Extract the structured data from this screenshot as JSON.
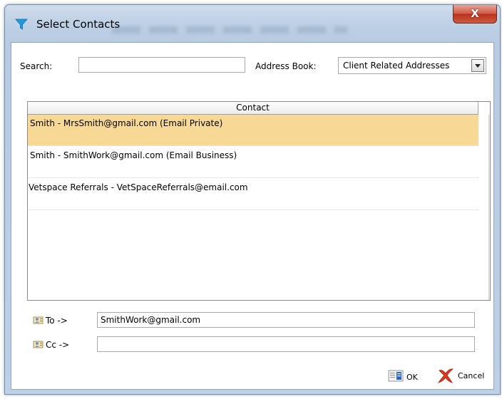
{
  "window": {
    "title": "Select Contacts",
    "close_glyph": "X"
  },
  "search": {
    "label": "Search:",
    "value": ""
  },
  "address_book": {
    "label": "Address Book:",
    "selected": "Client Related Addresses"
  },
  "contacts": {
    "column_header": "Contact",
    "rows": [
      {
        "text": "Smith - MrsSmith@gmail.com (Email Private)",
        "selected": true
      },
      {
        "text": "Smith - SmithWork@gmail.com (Email Business)",
        "selected": false
      },
      {
        "text": "Vetspace Referrals - VetSpaceReferrals@email.com",
        "selected": false
      }
    ]
  },
  "recipients": {
    "to_label": "To ->",
    "to_value": "SmithWork@gmail.com",
    "cc_label": "Cc ->",
    "cc_value": ""
  },
  "actions": {
    "ok_label": "OK",
    "cancel_label": "Cancel"
  },
  "colors": {
    "selected_row": "#f7d895",
    "close_button": "#c9452f",
    "scroll_thumb": "#8aa6d2"
  },
  "icons": {
    "app": "filter-funnel-icon",
    "to": "address-card-icon",
    "cc": "address-card-icon",
    "ok": "form-ok-icon",
    "cancel": "red-x-icon"
  }
}
